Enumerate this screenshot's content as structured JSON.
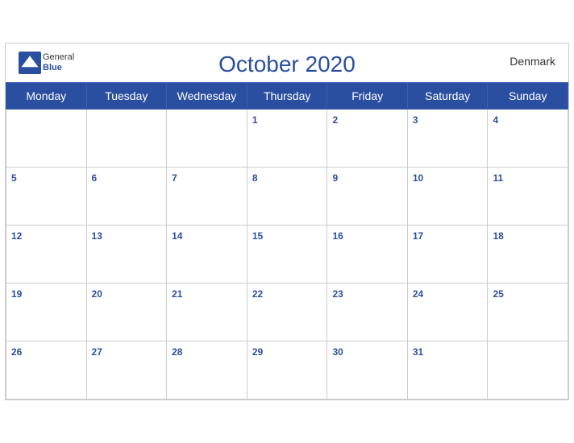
{
  "header": {
    "title": "October 2020",
    "country": "Denmark",
    "brand_general": "General",
    "brand_blue": "Blue"
  },
  "weekdays": [
    "Monday",
    "Tuesday",
    "Wednesday",
    "Thursday",
    "Friday",
    "Saturday",
    "Sunday"
  ],
  "weeks": [
    [
      null,
      null,
      null,
      1,
      2,
      3,
      4
    ],
    [
      5,
      6,
      7,
      8,
      9,
      10,
      11
    ],
    [
      12,
      13,
      14,
      15,
      16,
      17,
      18
    ],
    [
      19,
      20,
      21,
      22,
      23,
      24,
      25
    ],
    [
      26,
      27,
      28,
      29,
      30,
      31,
      null
    ]
  ]
}
